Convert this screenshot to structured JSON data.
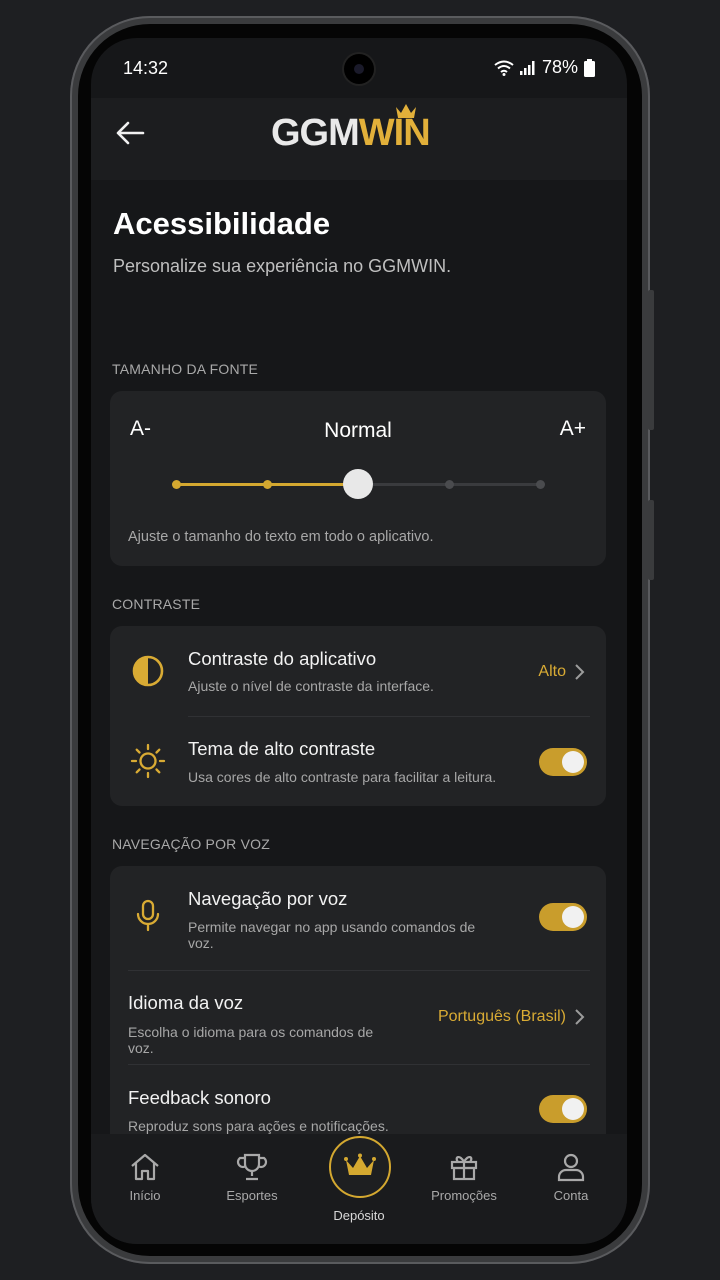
{
  "status_bar": {
    "time": "14:32",
    "battery": "78%"
  },
  "header": {
    "logo_part1": "GGM",
    "logo_part2": "WIN"
  },
  "page": {
    "title": "Acessibilidade",
    "subtitle": "Personalize sua experiência no GGMWIN."
  },
  "font_size": {
    "section_title": "TAMANHO DA FONTE",
    "decrease_label": "A-",
    "increase_label": "A+",
    "current_label": "Normal",
    "level_index": 2,
    "level_count": 5,
    "hint": "Ajuste o tamanho do texto em todo o aplicativo."
  },
  "contrast": {
    "section_title": "CONTRASTE",
    "app_contrast": {
      "title": "Contraste do aplicativo",
      "subtitle": "Ajuste o nível de contraste da interface.",
      "value": "Alto",
      "icon": "contrast-icon"
    },
    "high_contrast_theme": {
      "title": "Tema de alto contraste",
      "subtitle": "Usa cores de alto contraste para facilitar a leitura.",
      "enabled": true,
      "icon": "sun-icon"
    }
  },
  "voice": {
    "section_title": "NAVEGAÇÃO POR VOZ",
    "voice_nav": {
      "title": "Navegação por voz",
      "subtitle_line1": "Permite navegar no app usando comandos de",
      "subtitle_line2": "voz.",
      "enabled": true,
      "icon": "microphone-icon"
    },
    "voice_language": {
      "title": "Idioma da voz",
      "subtitle_line1": "Escolha o idioma para os comandos de",
      "subtitle_line2": "voz.",
      "value": "Português (Brasil)"
    },
    "sound_feedback": {
      "title": "Feedback sonoro",
      "subtitle": "Reproduz sons para ações e notificações.",
      "enabled": true
    }
  },
  "bottom_nav": {
    "home": "Início",
    "sports": "Esportes",
    "deposit": "Depósito",
    "promotions": "Promoções",
    "account": "Conta"
  },
  "colors": {
    "accent": "#d4a830",
    "background": "#161719",
    "card": "#222325"
  }
}
